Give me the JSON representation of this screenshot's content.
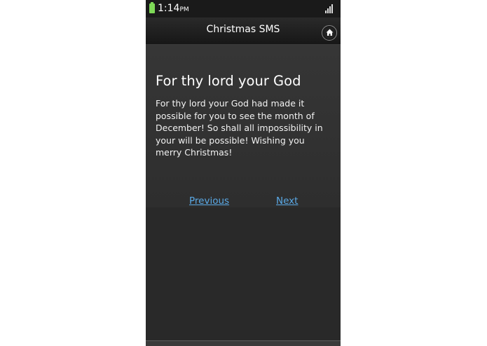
{
  "status_bar": {
    "time": "1:14",
    "ampm": "PM",
    "battery_color": "#7ed957"
  },
  "app_bar": {
    "title": "Christmas SMS",
    "home_icon": "home-icon"
  },
  "message": {
    "title": "For thy lord your God",
    "body": "For thy lord your God had made it possible for you to see the month of December! So shall all impossibility in your will be possible! Wishing you merry Christmas!"
  },
  "navigation": {
    "previous_label": "Previous",
    "next_label": "Next",
    "link_color": "#5aa9e6"
  }
}
